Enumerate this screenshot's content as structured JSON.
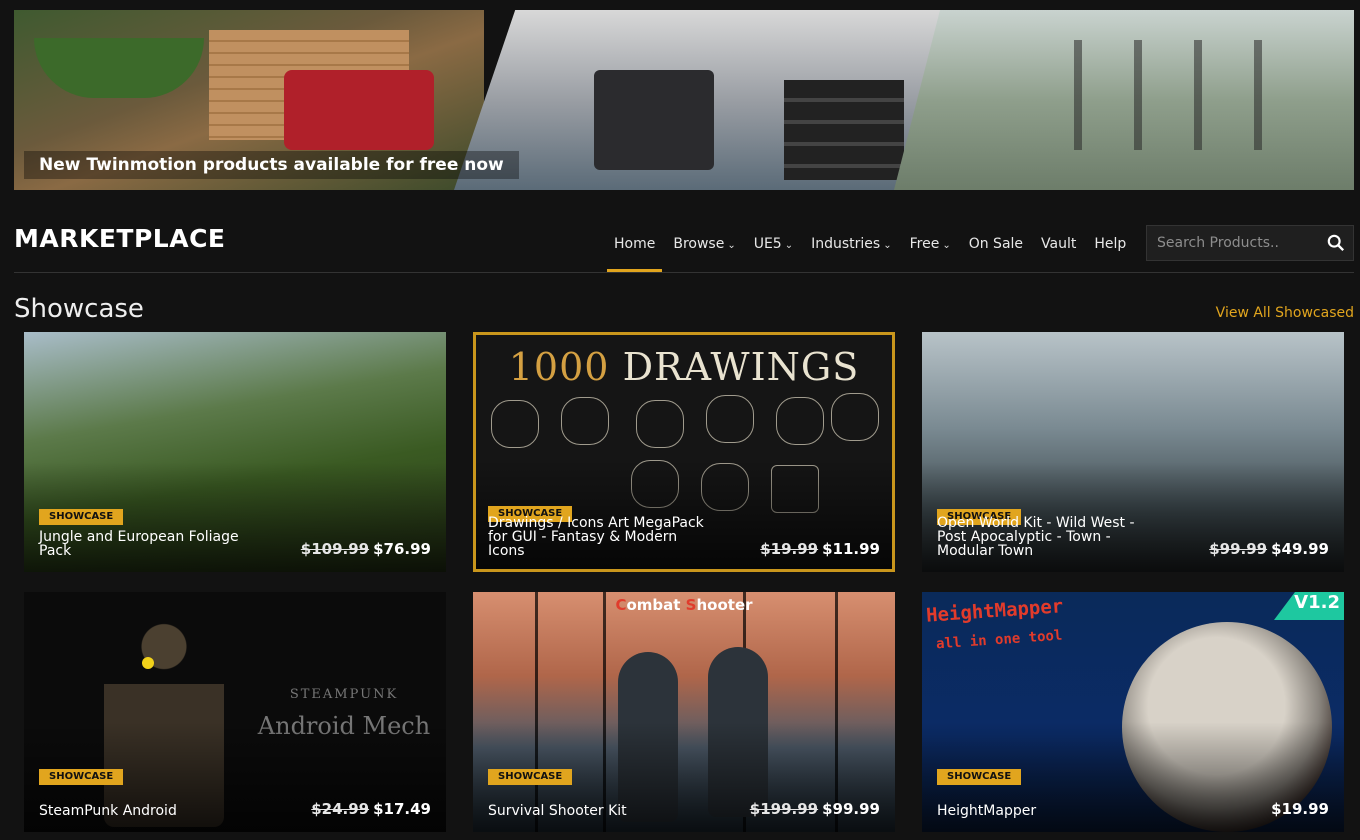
{
  "banner": {
    "caption": "New Twinmotion products available for free now"
  },
  "header": {
    "logo": "MARKETPLACE",
    "nav": [
      {
        "label": "Home",
        "dropdown": false,
        "active": true
      },
      {
        "label": "Browse",
        "dropdown": true,
        "active": false
      },
      {
        "label": "UE5",
        "dropdown": true,
        "active": false
      },
      {
        "label": "Industries",
        "dropdown": true,
        "active": false
      },
      {
        "label": "Free",
        "dropdown": true,
        "active": false
      },
      {
        "label": "On Sale",
        "dropdown": false,
        "active": false
      },
      {
        "label": "Vault",
        "dropdown": false,
        "active": false
      },
      {
        "label": "Help",
        "dropdown": false,
        "active": false
      }
    ],
    "search": {
      "placeholder": "Search Products..",
      "value": ""
    }
  },
  "showcase": {
    "title": "Showcase",
    "view_all": "View All Showcased",
    "cards": [
      {
        "badge": "SHOWCASE",
        "title": "Jungle and European Foliage Pack",
        "old_price": "$109.99",
        "price": "$76.99"
      },
      {
        "badge": "SHOWCASE",
        "title": "Drawings / Icons Art MegaPack for GUI - Fantasy & Modern Icons",
        "old_price": "$19.99",
        "price": "$11.99",
        "art": {
          "num": "1000",
          "word": "DRAWINGS"
        }
      },
      {
        "badge": "SHOWCASE",
        "title": "Open World Kit - Wild West - Post Apocalyptic - Town - Modular Town",
        "old_price": "$99.99",
        "price": "$49.99"
      },
      {
        "badge": "SHOWCASE",
        "title": "SteamPunk Android",
        "old_price": "$24.99",
        "price": "$17.49",
        "art": {
          "line1": "STEAMPUNK",
          "line2": "Android Mech"
        }
      },
      {
        "badge": "SHOWCASE",
        "title": "Survival Shooter Kit",
        "old_price": "$199.99",
        "price": "$99.99",
        "art": {
          "top_a": "C",
          "top_b": "ombat ",
          "top_c": "S",
          "top_d": "hooter"
        }
      },
      {
        "badge": "SHOWCASE",
        "title": "HeightMapper",
        "old_price": "",
        "price": "$19.99",
        "art": {
          "headline": "HeightMapper",
          "sub": "all in one tool",
          "version": "V1.2"
        }
      }
    ]
  },
  "colors": {
    "accent": "#e1a51e",
    "background": "#121212"
  }
}
